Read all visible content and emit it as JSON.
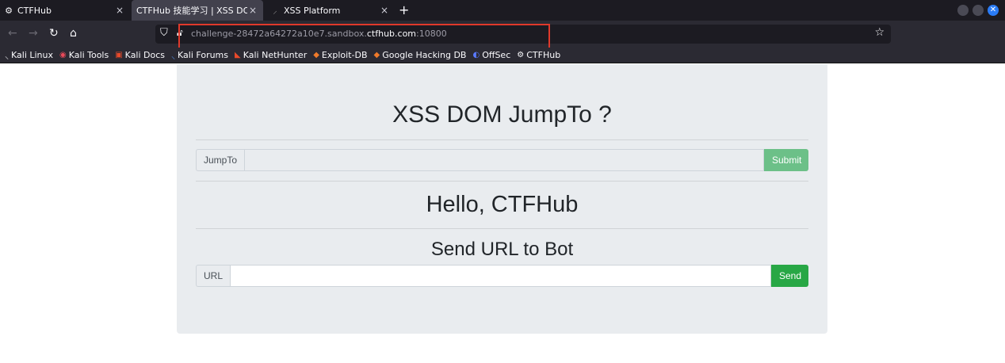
{
  "browser": {
    "tabs": [
      {
        "label": "CTFHub",
        "icon": "ctfhub-favicon"
      },
      {
        "label": "CTFHub 技能学习 | XSS DOM",
        "icon": "none"
      },
      {
        "label": "XSS Platform",
        "icon": "xss-platform-favicon"
      }
    ],
    "address": {
      "prefix": "challenge-28472a64272a10e7.sandbox.",
      "domain": "ctfhub.com",
      "port": ":10800"
    },
    "bookmarks": [
      {
        "label": "Kali Linux"
      },
      {
        "label": "Kali Tools"
      },
      {
        "label": "Kali Docs"
      },
      {
        "label": "Kali Forums"
      },
      {
        "label": "Kali NetHunter"
      },
      {
        "label": "Exploit-DB"
      },
      {
        "label": "Google Hacking DB"
      },
      {
        "label": "OffSec"
      },
      {
        "label": "CTFHub"
      }
    ]
  },
  "page": {
    "title": "XSS DOM JumpTo ?",
    "jumpto": {
      "prefix": "JumpTo",
      "value": "",
      "button": "Submit"
    },
    "greeting": "Hello, CTFHub",
    "bot_heading": "Send URL to Bot",
    "url": {
      "prefix": "URL",
      "value": "",
      "button": "Send"
    }
  },
  "colors": {
    "tabbar_bg": "#1c1b22",
    "toolbar_bg": "#2b2a33",
    "panel_bg": "#e9ecef",
    "submit_btn": "#6cc088",
    "send_btn": "#28a745",
    "highlight_box": "#e0392b"
  }
}
